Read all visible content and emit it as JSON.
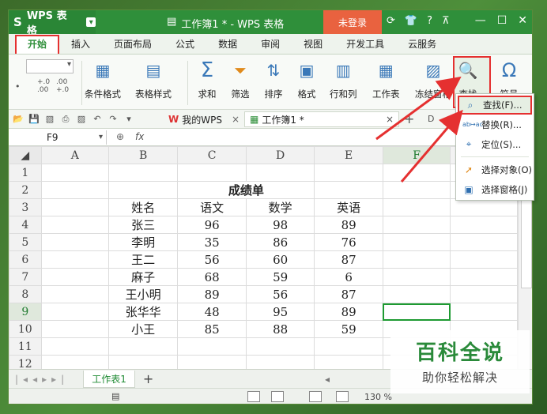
{
  "titlebar": {
    "app_name": "WPS 表格",
    "doc_title": "工作簿1 * - WPS 表格",
    "login": "未登录",
    "icons": [
      "refresh-icon",
      "shirt-icon",
      "help-icon",
      "collapse-icon"
    ]
  },
  "tabs": [
    "开始",
    "插入",
    "页面布局",
    "公式",
    "数据",
    "审阅",
    "视图",
    "开发工具",
    "云服务"
  ],
  "ribbon": {
    "items": [
      {
        "label": "条件格式",
        "icon": "▦"
      },
      {
        "label": "表格样式",
        "icon": "▤"
      },
      {
        "label": "求和",
        "icon": "Σ"
      },
      {
        "label": "筛选",
        "icon": "⏷"
      },
      {
        "label": "排序",
        "icon": "⇅"
      },
      {
        "label": "格式",
        "icon": "▣"
      },
      {
        "label": "行和列",
        "icon": "▥"
      },
      {
        "label": "工作表",
        "icon": "▦"
      },
      {
        "label": "冻结窗格",
        "icon": "▨"
      },
      {
        "label": "查找",
        "icon": "🔍"
      },
      {
        "label": "符号",
        "icon": "Ω"
      }
    ],
    "small_left": {
      "comma": "•",
      "inc": "+.0 .00",
      "dec": ".00 +.0"
    }
  },
  "quick_access": {
    "wps_tab": "我的WPS",
    "book_tab": "工作簿1 *"
  },
  "formula_bar": {
    "cell_ref": "F9",
    "fx": "fx",
    "value": ""
  },
  "sheet": {
    "columns": [
      "A",
      "B",
      "C",
      "D",
      "E",
      "F"
    ],
    "rows": [
      "1",
      "2",
      "3",
      "4",
      "5",
      "6",
      "7",
      "8",
      "9",
      "10",
      "11",
      "12"
    ],
    "title": "成绩单",
    "headers": [
      "姓名",
      "语文",
      "数学",
      "英语"
    ],
    "data": [
      [
        "张三",
        "96",
        "98",
        "89"
      ],
      [
        "李明",
        "35",
        "86",
        "76"
      ],
      [
        "王二",
        "56",
        "60",
        "87"
      ],
      [
        "麻子",
        "68",
        "59",
        "6"
      ],
      [
        "王小明",
        "89",
        "56",
        "87"
      ],
      [
        "张华华",
        "48",
        "95",
        "89"
      ],
      [
        "小王",
        "85",
        "88",
        "59"
      ]
    ]
  },
  "sheet_tab": "工作表1",
  "status": {
    "zoom": "130 %"
  },
  "menu": {
    "items": [
      "查找(F)...",
      "替换(R)...",
      "定位(S)...",
      "选择对象(O)",
      "选择窗格(J)"
    ],
    "icons": [
      "search-icon",
      "replace-icon",
      "goto-icon",
      "select-object-icon",
      "selection-pane-icon"
    ]
  },
  "watermark": {
    "big": "百科全说",
    "small": "助你轻松解决"
  },
  "colors": {
    "brand_green": "#2f8f3a",
    "highlight_red": "#e53030",
    "login_orange": "#e9623f"
  }
}
